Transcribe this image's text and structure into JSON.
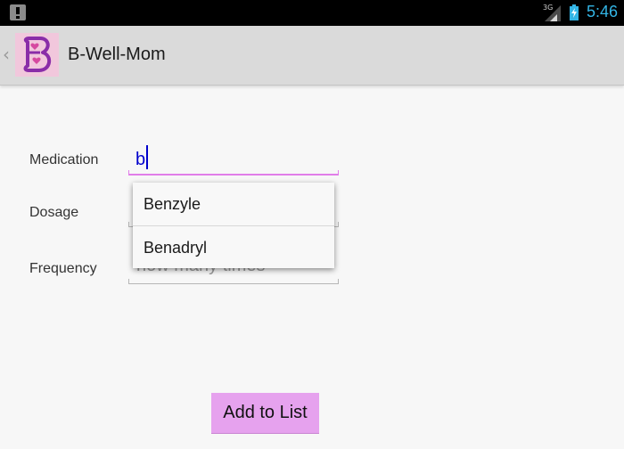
{
  "status_bar": {
    "network_type": "3G",
    "time": "5:46",
    "icons": [
      "notification-alert-icon",
      "signal-icon",
      "battery-charging-icon"
    ],
    "accent_color": "#33b5e5"
  },
  "action_bar": {
    "title": "B-Well-Mom",
    "logo_letter": "B",
    "icons": [
      "back-caret-icon",
      "app-logo-icon"
    ],
    "logo_bg_color": "#f1c7dc",
    "logo_ink_color": "#8a2da8"
  },
  "form": {
    "medication": {
      "label": "Medication",
      "value": "b"
    },
    "dosage": {
      "label": "Dosage"
    },
    "frequency": {
      "label": "Frequency",
      "placeholder": "how many times"
    },
    "autocomplete": {
      "options": [
        "Benzyle",
        "Benadryl"
      ]
    },
    "focus_color": "#e17ee9"
  },
  "add_button": {
    "label": "Add to List",
    "color": "#e6a2ee"
  }
}
